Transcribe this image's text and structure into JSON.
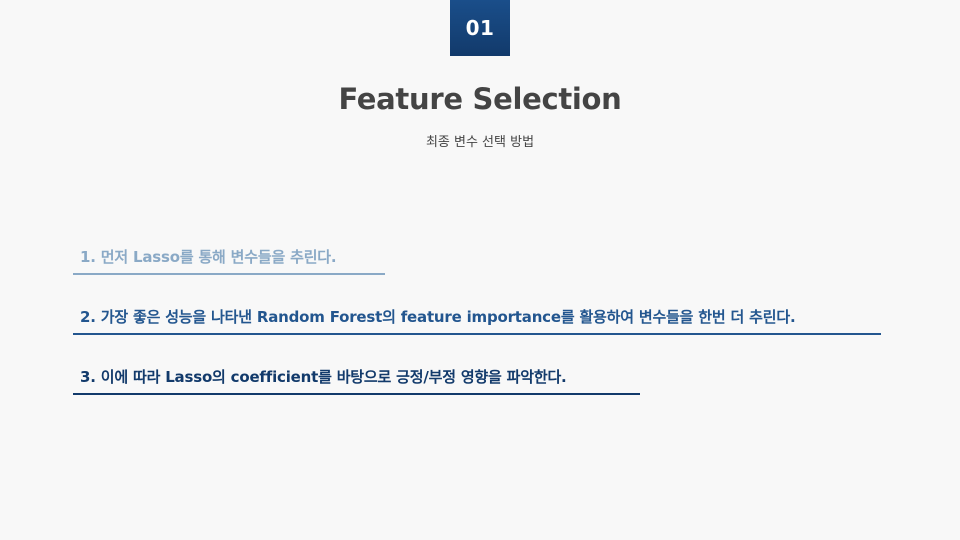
{
  "badge": {
    "number": "01"
  },
  "header": {
    "title": "Feature Selection",
    "subtitle": "최종 변수 선택 방법"
  },
  "steps": [
    {
      "text": "1. 먼저 Lasso를 통해 변수들을 추린다."
    },
    {
      "text": "2. 가장 좋은 성능을 나타낸 Random Forest의 feature importance를 활용하여 변수들을 한번 더 추린다."
    },
    {
      "text": "3. 이에 따라 Lasso의 coefficient를 바탕으로 긍정/부정 영향을 파악한다."
    }
  ],
  "colors": {
    "badge_background": "#123a6b",
    "step1": "#8aa9c6",
    "step2": "#23568f",
    "step3": "#123a6b",
    "title": "#444444",
    "background": "#f8f8f8"
  }
}
